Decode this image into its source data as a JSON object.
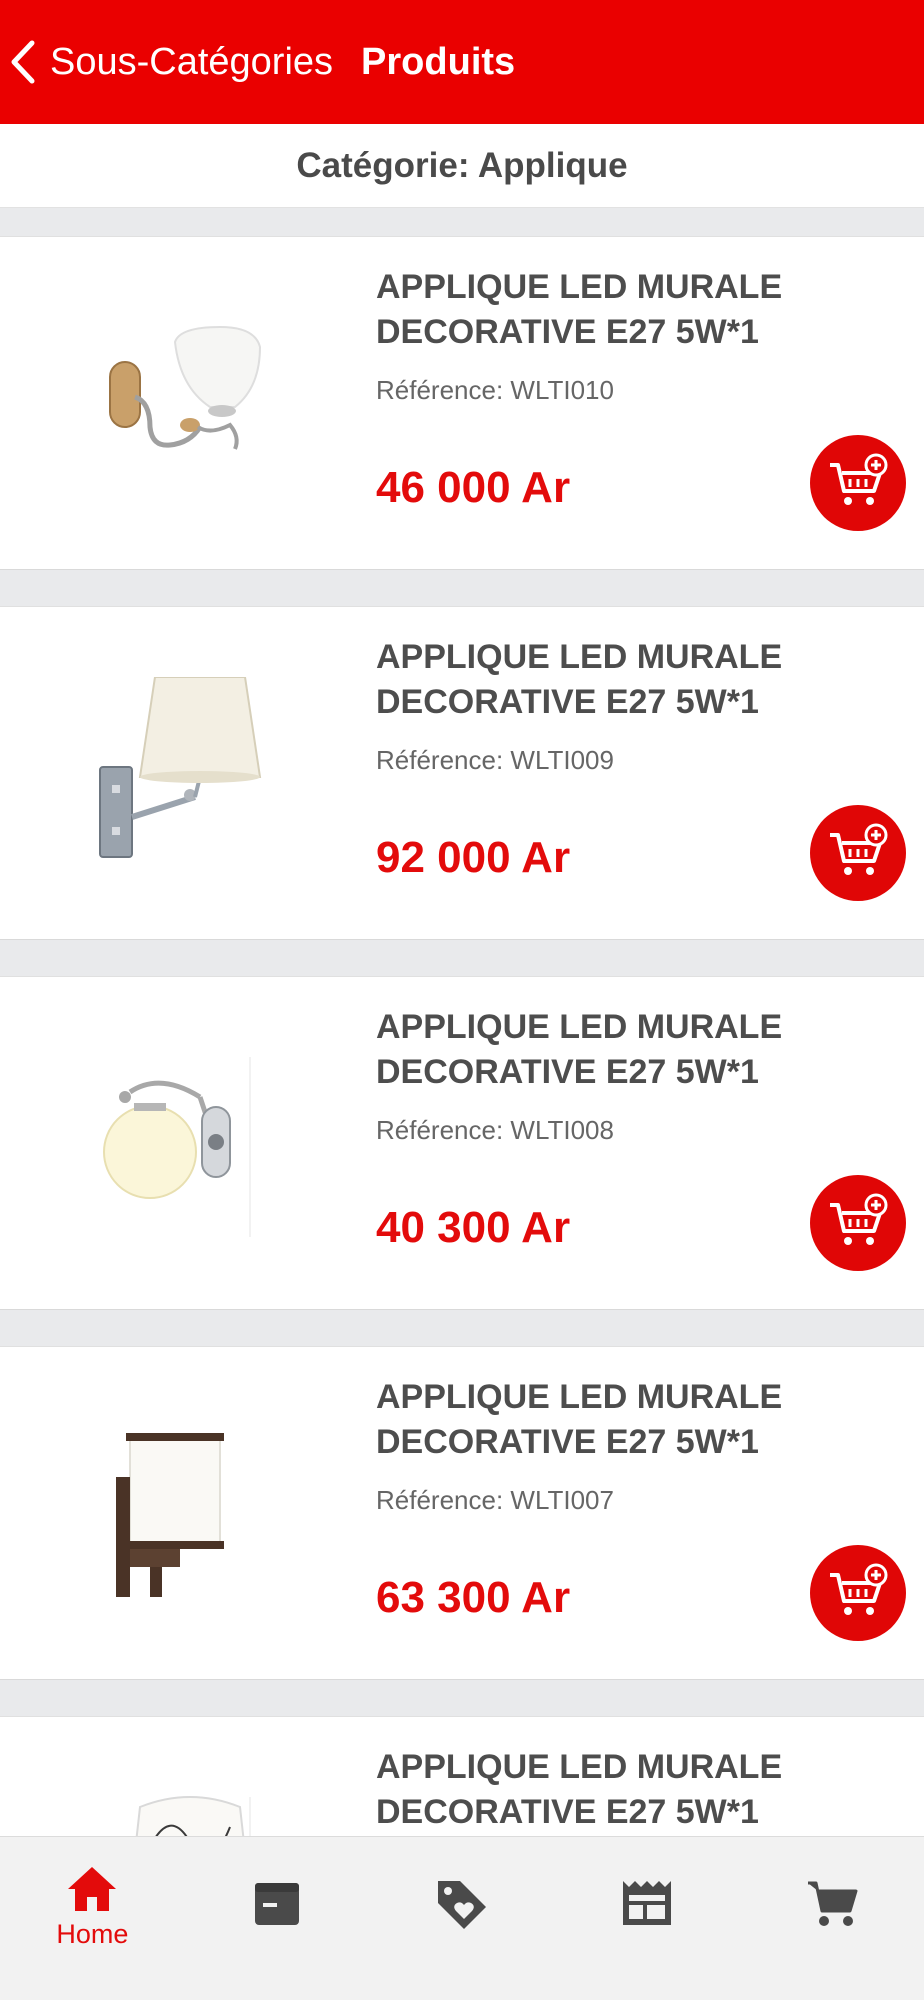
{
  "nav": {
    "back_label": "Sous-Catégories",
    "title": "Produits",
    "bar_color": "#ea0000"
  },
  "category_label": "Catégorie: Applique",
  "products": [
    {
      "name_line1": "APPLIQUE LED MURALE",
      "name_line2": "DECORATIVE E27 5W*1",
      "reference": "Référence: WLTI010",
      "price": "46 000 Ar",
      "image": "wall-lamp-glass-tulip"
    },
    {
      "name_line1": "APPLIQUE LED MURALE",
      "name_line2": "DECORATIVE E27 5W*1",
      "reference": "Référence: WLTI009",
      "price": "92 000 Ar",
      "image": "wall-lamp-fabric-shade"
    },
    {
      "name_line1": "APPLIQUE LED MURALE",
      "name_line2": "DECORATIVE E27 5W*1",
      "reference": "Référence: WLTI008",
      "price": "40 300 Ar",
      "image": "wall-lamp-globe"
    },
    {
      "name_line1": "APPLIQUE LED MURALE",
      "name_line2": "DECORATIVE E27 5W*1",
      "reference": "Référence: WLTI007",
      "price": "63 300 Ar",
      "image": "wall-lamp-square-wood"
    },
    {
      "name_line1": "APPLIQUE LED MURALE",
      "name_line2": "DECORATIVE E27 5W*1",
      "reference": "",
      "price": "",
      "image": "wall-lamp-patterned"
    }
  ],
  "cart_icon": "add-to-cart-icon",
  "tabbar": {
    "active_color": "#e30b0b",
    "inactive_color": "#4a4a4a",
    "tabs": [
      {
        "label": "Home",
        "icon": "home-icon",
        "active": true
      },
      {
        "label": "",
        "icon": "store-icon",
        "active": false
      },
      {
        "label": "",
        "icon": "tag-heart-icon",
        "active": false
      },
      {
        "label": "",
        "icon": "news-icon",
        "active": false
      },
      {
        "label": "",
        "icon": "cart-icon",
        "active": false
      }
    ]
  }
}
